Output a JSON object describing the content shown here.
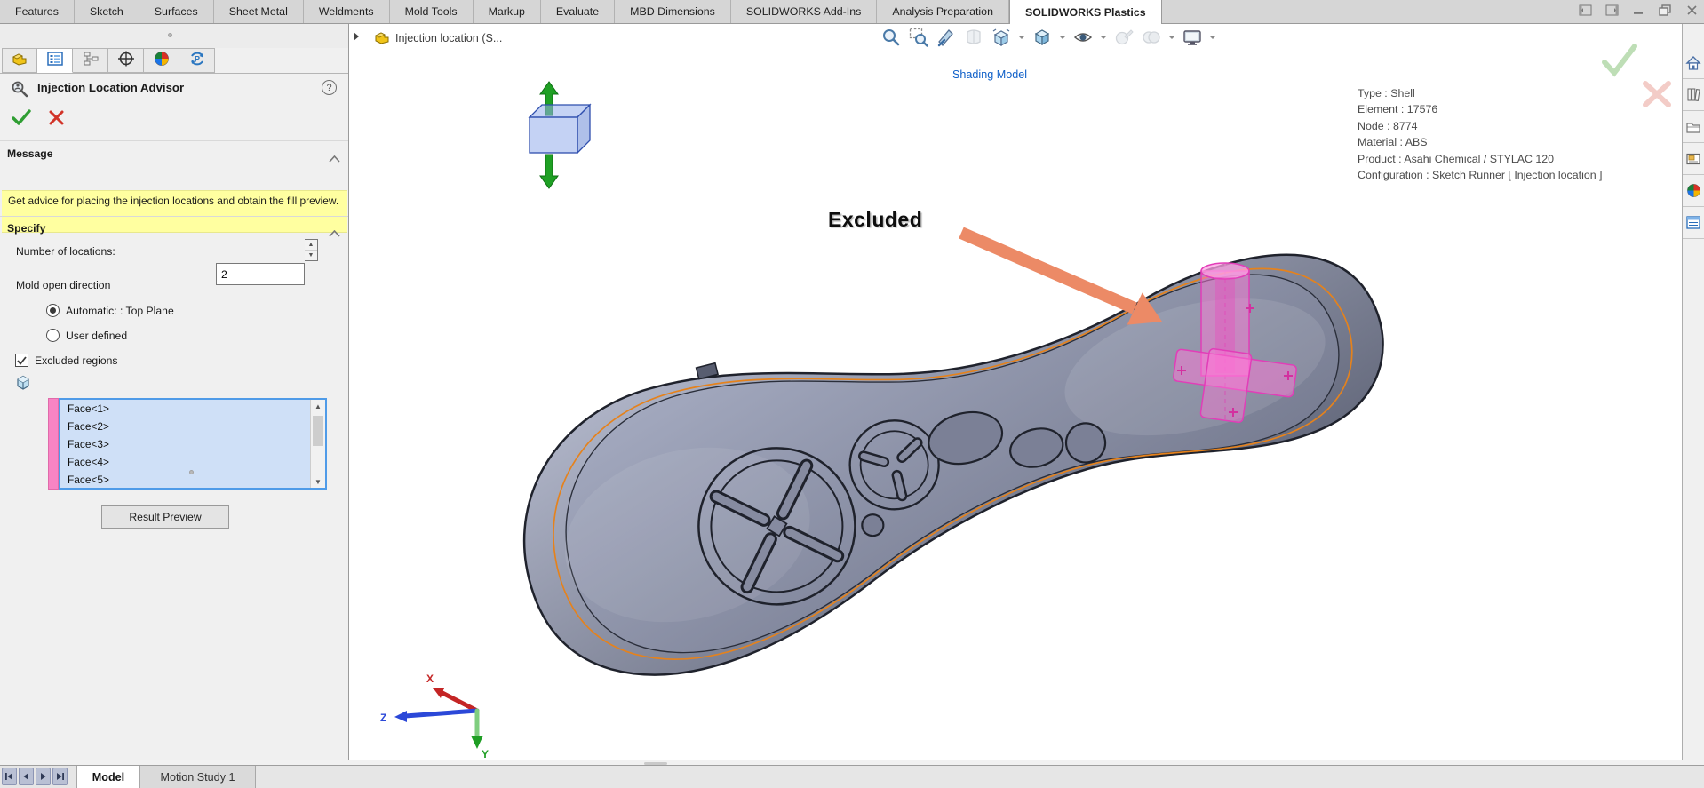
{
  "ribbon": {
    "tabs": [
      "Features",
      "Sketch",
      "Surfaces",
      "Sheet Metal",
      "Weldments",
      "Mold Tools",
      "Markup",
      "Evaluate",
      "MBD Dimensions",
      "SOLIDWORKS Add-Ins",
      "Analysis Preparation",
      "SOLIDWORKS Plastics"
    ],
    "active_tab": "SOLIDWORKS Plastics"
  },
  "panel": {
    "title": "Injection Location Advisor",
    "help": "?",
    "message_header": "Message",
    "message_text": "Get advice for placing the injection locations and obtain the fill preview.",
    "specify_header": "Specify",
    "number_of_locations_label": "Number of locations:",
    "number_of_locations_value": "2",
    "mold_open_direction_label": "Mold open direction",
    "radio_automatic_label": "Automatic: : Top Plane",
    "radio_user_defined_label": "User defined",
    "excluded_regions_label": "Excluded regions",
    "faces": [
      "Face<1>",
      "Face<2>",
      "Face<3>",
      "Face<4>",
      "Face<5>"
    ],
    "result_preview_label": "Result Preview"
  },
  "viewport": {
    "breadcrumb": "Injection location (S...",
    "shading_model_label": "Shading Model",
    "excluded_annotation": "Excluded",
    "info_lines": [
      "Type : Shell",
      "Element : 17576",
      "Node : 8774",
      "Material : ABS",
      "Product : Asahi Chemical / STYLAC 120",
      "Configuration : Sketch Runner [ Injection location ]"
    ],
    "triad_labels": {
      "x": "X",
      "y": "Y",
      "z": "Z"
    }
  },
  "bottom_bar": {
    "model_tab": "Model",
    "motion_tab": "Motion Study 1"
  },
  "icons": {
    "zoom-fit-icon": "magnifier",
    "zoom-area-icon": "magnifier+dashed-box",
    "section-view-icon": "section wedge",
    "view-orientation-icon": "cube",
    "display-style-icon": "shaded cube",
    "hide-show-items-icon": "eye",
    "edit-appearance-icon": "sphere+pencil",
    "apply-scene-icon": "scene spheres",
    "view-settings-icon": "monitor",
    "ok-icon": "green check",
    "cancel-icon": "red cross"
  },
  "colors": {
    "accent_blue": "#0e5fc8",
    "highlight_pink": "#ff7ad2",
    "arrow_salmon": "#ec8a66",
    "selection_blue_bg": "#cfe0f7",
    "message_yellow": "#ffffa0",
    "orange_rim": "#e5821c"
  }
}
